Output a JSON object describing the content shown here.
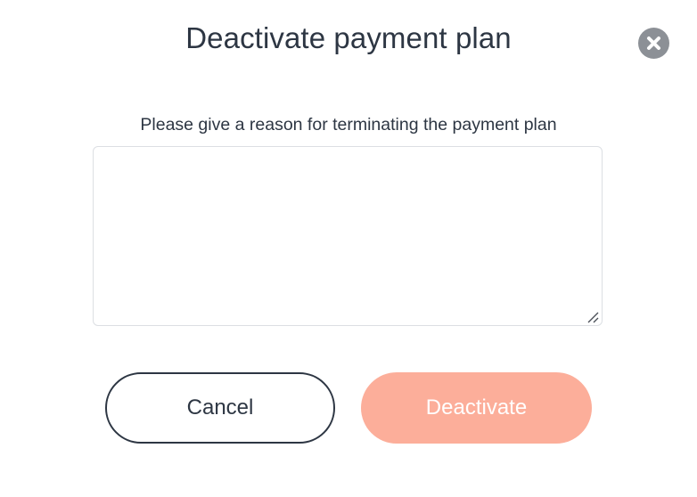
{
  "dialog": {
    "title": "Deactivate payment plan",
    "close_icon": "close-circle-icon",
    "prompt": "Please give a reason for terminating the payment plan",
    "reason_value": "",
    "reason_placeholder": "",
    "cancel_label": "Cancel",
    "deactivate_label": "Deactivate",
    "deactivate_enabled": false
  },
  "colors": {
    "text": "#2d3643",
    "close_icon_bg": "#8c9096",
    "input_border": "#dcdfe3",
    "deactivate_bg": "#fcae9a",
    "deactivate_text": "#ffffff"
  }
}
